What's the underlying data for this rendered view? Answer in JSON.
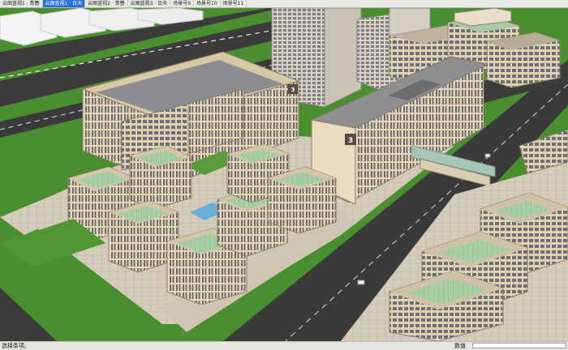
{
  "tabs": [
    {
      "label": "云图蓝视1 · 青簪"
    },
    {
      "label": "云图蓝视1 · 日天",
      "active": true
    },
    {
      "label": "云图蓝视2 · 青簪"
    },
    {
      "label": "云图蓝视3 · 日天"
    },
    {
      "label": "场景号9"
    },
    {
      "label": "场景号10"
    },
    {
      "label": "场景号11"
    }
  ],
  "scene": {
    "building_numbers": [
      "3",
      "3"
    ]
  },
  "status": {
    "text": "选择条项。",
    "measure_label": "数值",
    "measure_value": ""
  },
  "colors": {
    "active_tab": "#2b6fd6",
    "grass": "#4a8f2f",
    "road": "#3a3a3a",
    "facade": "#efe0c1",
    "roof": "#8c8c8c",
    "green_roof": "#9fc59a"
  }
}
